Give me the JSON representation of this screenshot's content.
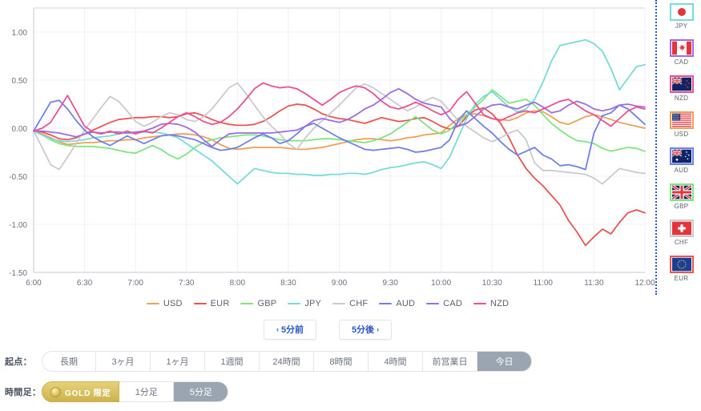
{
  "chart_data": {
    "type": "line",
    "title": "",
    "xlabel": "",
    "ylabel": "",
    "ylim": [
      -1.5,
      1.25
    ],
    "xlim": [
      0,
      72
    ],
    "grid": true,
    "legend_position": "bottom",
    "y_ticks": [
      "1.00",
      "0.50",
      "0.00",
      "-0.50",
      "-1.00",
      "-1.50"
    ],
    "y_tick_values": [
      1.0,
      0.5,
      0.0,
      -0.5,
      -1.0,
      -1.5
    ],
    "x_ticks": [
      "6:00",
      "6:30",
      "7:00",
      "7:30",
      "8:00",
      "8:30",
      "9:00",
      "9:30",
      "10:00",
      "10:30",
      "11:00",
      "11:30",
      "12:00"
    ],
    "x_tick_values": [
      0,
      6,
      12,
      18,
      24,
      30,
      36,
      42,
      48,
      54,
      60,
      66,
      72
    ],
    "series": [
      {
        "name": "USD",
        "color": "#f0a055",
        "values": [
          -0.03,
          -0.06,
          -0.1,
          -0.14,
          -0.17,
          -0.16,
          -0.15,
          -0.15,
          -0.14,
          -0.13,
          -0.13,
          -0.12,
          -0.12,
          -0.1,
          -0.09,
          -0.08,
          -0.07,
          -0.06,
          -0.06,
          -0.07,
          -0.09,
          -0.12,
          -0.17,
          -0.21,
          -0.22,
          -0.21,
          -0.2,
          -0.2,
          -0.2,
          -0.2,
          -0.21,
          -0.22,
          -0.22,
          -0.21,
          -0.2,
          -0.18,
          -0.16,
          -0.14,
          -0.12,
          -0.11,
          -0.11,
          -0.12,
          -0.13,
          -0.12,
          -0.1,
          -0.09,
          -0.07,
          -0.06,
          -0.05,
          0.03,
          0.1,
          0.14,
          0.15,
          0.13,
          0.1,
          0.09,
          0.08,
          0.11,
          0.16,
          0.18,
          0.17,
          0.12,
          0.06,
          0.04,
          0.08,
          0.12,
          0.14,
          0.12,
          0.09,
          0.06,
          0.04,
          0.02,
          0.0
        ]
      },
      {
        "name": "EUR",
        "color": "#ef5350",
        "values": [
          -0.03,
          -0.04,
          -0.07,
          -0.11,
          -0.12,
          -0.1,
          -0.06,
          -0.02,
          0.02,
          0.06,
          0.09,
          0.1,
          0.11,
          0.11,
          0.12,
          0.12,
          0.11,
          0.12,
          0.15,
          0.16,
          0.13,
          0.09,
          0.06,
          0.04,
          0.03,
          0.03,
          0.04,
          0.07,
          0.12,
          0.18,
          0.23,
          0.25,
          0.24,
          0.2,
          0.15,
          0.12,
          0.1,
          0.09,
          0.07,
          0.05,
          0.08,
          0.11,
          0.09,
          0.07,
          0.08,
          0.1,
          0.11,
          0.07,
          0.02,
          -0.01,
          0.02,
          0.12,
          0.19,
          0.21,
          0.15,
          0.05,
          -0.1,
          -0.28,
          -0.42,
          -0.52,
          -0.6,
          -0.7,
          -0.8,
          -0.96,
          -1.08,
          -1.22,
          -1.13,
          -1.05,
          -1.1,
          -0.98,
          -0.88,
          -0.85,
          -0.88
        ]
      },
      {
        "name": "GBP",
        "color": "#7ee67e",
        "values": [
          -0.03,
          -0.07,
          -0.12,
          -0.16,
          -0.18,
          -0.19,
          -0.19,
          -0.19,
          -0.2,
          -0.21,
          -0.23,
          -0.25,
          -0.26,
          -0.22,
          -0.18,
          -0.22,
          -0.28,
          -0.32,
          -0.27,
          -0.2,
          -0.15,
          -0.12,
          -0.1,
          -0.09,
          -0.08,
          -0.07,
          -0.07,
          -0.08,
          -0.1,
          -0.12,
          -0.13,
          -0.13,
          -0.13,
          -0.12,
          -0.11,
          -0.11,
          -0.12,
          -0.13,
          -0.14,
          -0.15,
          -0.13,
          -0.1,
          -0.06,
          0.0,
          0.06,
          0.12,
          0.05,
          -0.02,
          -0.06,
          -0.02,
          0.06,
          0.14,
          0.22,
          0.3,
          0.4,
          0.33,
          0.26,
          0.28,
          0.3,
          0.24,
          0.14,
          0.05,
          -0.02,
          -0.08,
          -0.13,
          -0.14,
          -0.16,
          -0.21,
          -0.24,
          -0.22,
          -0.2,
          -0.21,
          -0.24
        ]
      },
      {
        "name": "JPY",
        "color": "#76dcd8",
        "values": [
          -0.03,
          -0.07,
          -0.11,
          -0.13,
          -0.14,
          -0.13,
          -0.12,
          -0.1,
          -0.09,
          -0.08,
          -0.06,
          -0.05,
          -0.05,
          -0.04,
          -0.04,
          -0.05,
          -0.07,
          -0.1,
          -0.16,
          -0.22,
          -0.28,
          -0.34,
          -0.42,
          -0.5,
          -0.58,
          -0.5,
          -0.42,
          -0.44,
          -0.46,
          -0.47,
          -0.47,
          -0.48,
          -0.48,
          -0.49,
          -0.49,
          -0.48,
          -0.48,
          -0.47,
          -0.47,
          -0.48,
          -0.46,
          -0.43,
          -0.41,
          -0.4,
          -0.38,
          -0.36,
          -0.35,
          -0.38,
          -0.42,
          -0.3,
          -0.1,
          0.1,
          0.25,
          0.33,
          0.38,
          0.3,
          0.22,
          0.17,
          0.2,
          0.3,
          0.48,
          0.7,
          0.86,
          0.88,
          0.9,
          0.92,
          0.88,
          0.8,
          0.62,
          0.4,
          0.52,
          0.64,
          0.66
        ]
      },
      {
        "name": "CHF",
        "color": "#c9cbd1",
        "values": [
          -0.03,
          -0.2,
          -0.38,
          -0.43,
          -0.3,
          -0.16,
          -0.02,
          0.1,
          0.22,
          0.33,
          0.28,
          0.18,
          0.07,
          0.02,
          0.06,
          0.12,
          0.16,
          0.14,
          0.09,
          0.07,
          0.12,
          0.2,
          0.31,
          0.42,
          0.47,
          0.36,
          0.24,
          0.12,
          0.02,
          -0.06,
          -0.16,
          -0.22,
          -0.1,
          0.0,
          0.08,
          0.16,
          0.24,
          0.33,
          0.42,
          0.46,
          0.42,
          0.36,
          0.3,
          0.24,
          0.18,
          0.22,
          0.28,
          0.32,
          0.28,
          0.18,
          0.08,
          0.02,
          -0.04,
          -0.1,
          -0.14,
          -0.1,
          -0.05,
          -0.02,
          -0.12,
          -0.36,
          -0.44,
          -0.44,
          -0.45,
          -0.46,
          -0.47,
          -0.48,
          -0.52,
          -0.58,
          -0.5,
          -0.42,
          -0.44,
          -0.46,
          -0.47
        ]
      },
      {
        "name": "AUD",
        "color": "#6f80ec",
        "values": [
          -0.03,
          0.12,
          0.27,
          0.29,
          0.2,
          0.08,
          -0.02,
          -0.09,
          -0.14,
          -0.18,
          -0.13,
          -0.08,
          -0.12,
          -0.16,
          -0.12,
          -0.08,
          -0.07,
          -0.08,
          -0.1,
          -0.12,
          -0.16,
          -0.2,
          -0.23,
          -0.22,
          -0.2,
          -0.15,
          -0.1,
          -0.06,
          -0.1,
          -0.16,
          -0.13,
          -0.06,
          0.02,
          0.05,
          0.0,
          -0.05,
          -0.1,
          -0.14,
          -0.18,
          -0.22,
          -0.23,
          -0.22,
          -0.21,
          -0.2,
          -0.22,
          -0.25,
          -0.24,
          -0.22,
          -0.2,
          -0.12,
          0.08,
          0.18,
          0.1,
          0.02,
          -0.05,
          -0.14,
          -0.22,
          -0.28,
          -0.24,
          -0.2,
          -0.28,
          -0.32,
          -0.39,
          -0.38,
          -0.4,
          -0.43,
          -0.05,
          0.13,
          0.16,
          0.24,
          0.2,
          0.12,
          0.04
        ]
      },
      {
        "name": "CAD",
        "color": "#9b6ee6",
        "values": [
          -0.03,
          -0.03,
          -0.04,
          -0.05,
          -0.07,
          -0.09,
          -0.06,
          -0.04,
          -0.05,
          -0.04,
          -0.04,
          -0.05,
          -0.04,
          -0.03,
          0.0,
          0.04,
          0.05,
          0.04,
          0.01,
          -0.04,
          -0.12,
          -0.19,
          -0.12,
          -0.06,
          -0.05,
          -0.05,
          -0.05,
          -0.05,
          -0.05,
          -0.04,
          -0.03,
          -0.02,
          0.02,
          0.08,
          0.1,
          0.08,
          0.06,
          0.09,
          0.14,
          0.2,
          0.24,
          0.3,
          0.37,
          0.41,
          0.36,
          0.3,
          0.26,
          0.24,
          0.22,
          0.1,
          0.02,
          0.05,
          0.12,
          0.2,
          0.24,
          0.25,
          0.22,
          0.2,
          0.24,
          0.27,
          0.22,
          0.16,
          0.18,
          0.24,
          0.28,
          0.25,
          0.2,
          0.18,
          0.2,
          0.24,
          0.25,
          0.23,
          0.22
        ]
      },
      {
        "name": "NZD",
        "color": "#ef4f92",
        "values": [
          -0.03,
          0.0,
          0.06,
          0.2,
          0.34,
          0.18,
          0.02,
          -0.04,
          -0.06,
          -0.03,
          -0.06,
          -0.03,
          -0.06,
          -0.03,
          -0.05,
          0.0,
          0.06,
          0.12,
          0.16,
          0.12,
          0.07,
          0.04,
          0.06,
          0.12,
          0.2,
          0.3,
          0.41,
          0.47,
          0.44,
          0.42,
          0.43,
          0.41,
          0.36,
          0.3,
          0.24,
          0.3,
          0.37,
          0.41,
          0.44,
          0.42,
          0.36,
          0.28,
          0.22,
          0.2,
          0.23,
          0.27,
          0.23,
          0.18,
          0.14,
          0.18,
          0.3,
          0.38,
          0.26,
          0.14,
          0.1,
          0.08,
          0.12,
          0.16,
          0.18,
          0.16,
          0.2,
          0.24,
          0.28,
          0.3,
          0.24,
          0.18,
          0.14,
          0.08,
          0.02,
          0.1,
          0.18,
          0.22,
          0.2
        ]
      }
    ]
  },
  "legend": {
    "items": [
      {
        "label": "USD",
        "color": "#f0a055"
      },
      {
        "label": "EUR",
        "color": "#ef5350"
      },
      {
        "label": "GBP",
        "color": "#7ee67e"
      },
      {
        "label": "JPY",
        "color": "#76dcd8"
      },
      {
        "label": "CHF",
        "color": "#c9cbd1"
      },
      {
        "label": "AUD",
        "color": "#6f80ec"
      },
      {
        "label": "CAD",
        "color": "#9b6ee6"
      },
      {
        "label": "NZD",
        "color": "#ef4f92"
      }
    ]
  },
  "flags": {
    "items": [
      {
        "label": "JPY",
        "border_color": "#76dcd8",
        "icon": "flag-jp"
      },
      {
        "label": "CAD",
        "border_color": "#9b6ee6",
        "icon": "flag-ca"
      },
      {
        "label": "NZD",
        "border_color": "#ef4f92",
        "icon": "flag-nz"
      },
      {
        "label": "USD",
        "border_color": "#f0a055",
        "icon": "flag-us"
      },
      {
        "label": "AUD",
        "border_color": "#6f80ec",
        "icon": "flag-au"
      },
      {
        "label": "GBP",
        "border_color": "#7ee67e",
        "icon": "flag-gb"
      },
      {
        "label": "CHF",
        "border_color": "#c9cbd1",
        "icon": "flag-ch"
      },
      {
        "label": "EUR",
        "border_color": "#ef5350",
        "icon": "flag-eu"
      }
    ]
  },
  "nav": {
    "prev_chevron": "‹",
    "prev_label": "5分前",
    "next_label": "5分後",
    "next_chevron": "›"
  },
  "period": {
    "label": "起点：",
    "options": [
      {
        "label": "長期",
        "active": false
      },
      {
        "label": "3ヶ月",
        "active": false
      },
      {
        "label": "1ヶ月",
        "active": false
      },
      {
        "label": "1週間",
        "active": false
      },
      {
        "label": "24時間",
        "active": false
      },
      {
        "label": "8時間",
        "active": false
      },
      {
        "label": "4時間",
        "active": false
      },
      {
        "label": "前営業日",
        "active": false
      },
      {
        "label": "今日",
        "active": true
      }
    ]
  },
  "timeframe": {
    "label": "時間足：",
    "gold_badge": "GOLD 限定",
    "options": [
      {
        "label": "1分足",
        "active": false
      },
      {
        "label": "5分足",
        "active": true
      }
    ]
  },
  "colors": {
    "accent_blue": "#2b56c8",
    "active_gray": "#9aa5b1",
    "gold": "#cdb24e",
    "grid": "#eef0f3"
  }
}
